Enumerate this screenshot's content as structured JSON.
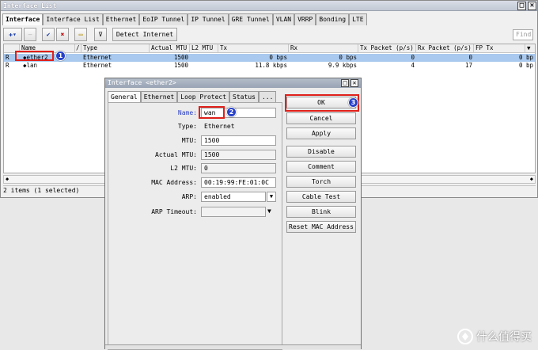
{
  "window": {
    "title": "Interface List",
    "tabs": [
      "Interface",
      "Interface List",
      "Ethernet",
      "EoIP Tunnel",
      "IP Tunnel",
      "GRE Tunnel",
      "VLAN",
      "VRRP",
      "Bonding",
      "LTE"
    ],
    "toolbar": {
      "add_glyph": "✚▾",
      "remove_glyph": "—",
      "enable_glyph": "✔",
      "disable_glyph": "✖",
      "comment_glyph": "▭",
      "filter_glyph": "⊽",
      "detect_label": "Detect Internet",
      "find_placeholder": "Find"
    },
    "table": {
      "columns": [
        "Name",
        "/",
        "Type",
        "Actual MTU",
        "L2 MTU",
        "Tx",
        "Rx",
        "Tx Packet (p/s)",
        "Rx Packet (p/s)",
        "FP Tx"
      ],
      "rows": [
        {
          "flag": "R",
          "name": "◆ether2",
          "type": "Ethernet",
          "actual_mtu": "1500",
          "l2_mtu": "",
          "tx": "0 bps",
          "rx": "0 bps",
          "tx_pps": "0",
          "rx_pps": "0",
          "fp_tx": "0 bp"
        },
        {
          "flag": "R",
          "name": "◆lan",
          "type": "Ethernet",
          "actual_mtu": "1500",
          "l2_mtu": "",
          "tx": "11.8 kbps",
          "rx": "9.9 kbps",
          "tx_pps": "4",
          "rx_pps": "17",
          "fp_tx": "0 bp"
        }
      ]
    },
    "status": "2 items (1 selected)"
  },
  "dialog": {
    "title": "Interface <ether2>",
    "tabs": [
      "General",
      "Ethernet",
      "Loop Protect",
      "Status",
      "..."
    ],
    "fields": {
      "name_label": "Name:",
      "name_value": "wan",
      "type_label": "Type:",
      "type_value": "Ethernet",
      "mtu_label": "MTU:",
      "mtu_value": "1500",
      "actual_mtu_label": "Actual MTU:",
      "actual_mtu_value": "1500",
      "l2mtu_label": "L2 MTU:",
      "l2mtu_value": "0",
      "mac_label": "MAC Address:",
      "mac_value": "00:19:99:FE:01:0C",
      "arp_label": "ARP:",
      "arp_value": "enabled",
      "arp_timeout_label": "ARP Timeout:",
      "arp_timeout_value": ""
    },
    "buttons": [
      "OK",
      "Cancel",
      "Apply",
      "Disable",
      "Comment",
      "Torch",
      "Cable Test",
      "Blink",
      "Reset MAC Address"
    ]
  },
  "annotations": [
    "1",
    "2",
    "3"
  ],
  "watermark": {
    "text": "什么值得买"
  },
  "colors": {
    "selection": "#a9c9ee",
    "highlight": "#e0201a",
    "badge": "#2741c9"
  }
}
